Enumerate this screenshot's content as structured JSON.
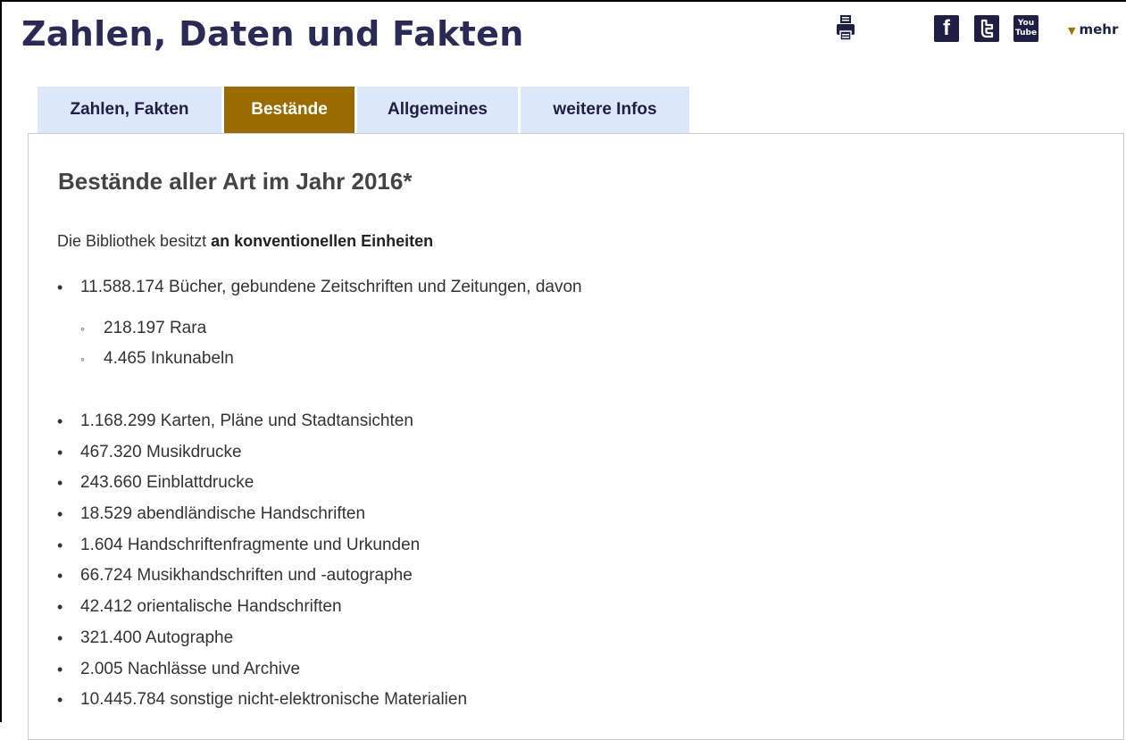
{
  "header": {
    "title": "Zahlen, Daten und Fakten",
    "more_label": "mehr",
    "icons": [
      "print-icon",
      "facebook-icon",
      "twitter-icon",
      "youtube-icon",
      "chevron-icon"
    ],
    "social": {
      "facebook": "f",
      "youtube_line1": "You",
      "youtube_line2": "Tube"
    }
  },
  "tabs": [
    {
      "label": "Zahlen, Fakten",
      "active": false
    },
    {
      "label": "Bestände",
      "active": true
    },
    {
      "label": "Allgemeines",
      "active": false
    },
    {
      "label": "weitere Infos",
      "active": false
    }
  ],
  "content": {
    "heading": "Bestände aller Art im Jahr 2016*",
    "intro_text": "Die Bibliothek besitzt",
    "intro_bold": "an konventionellen Einheiten",
    "main_item": "11.588.174 Bücher, gebundene Zeitschriften und Zeitungen, davon",
    "sub_items": [
      "218.197 Rara",
      "4.465 Inkunabeln"
    ],
    "items": [
      "1.168.299 Karten, Pläne und Stadtansichten",
      "467.320 Musikdrucke",
      "243.660 Einblattdrucke",
      "18.529 abendländische Handschriften",
      "1.604 Handschriftenfragmente und Urkunden",
      "66.724 Musikhandschriften und -autographe",
      "42.412 orientalische Handschriften",
      "321.400 Autographe",
      "2.005 Nachlässe und Archive",
      "10.445.784 sonstige nicht-elektronische Materialien"
    ]
  },
  "colors": {
    "title": "#2b2a55",
    "tab_inactive_bg": "#dce8f7",
    "tab_active_bg": "#9a6b00",
    "social_bg": "#1f1f45"
  }
}
